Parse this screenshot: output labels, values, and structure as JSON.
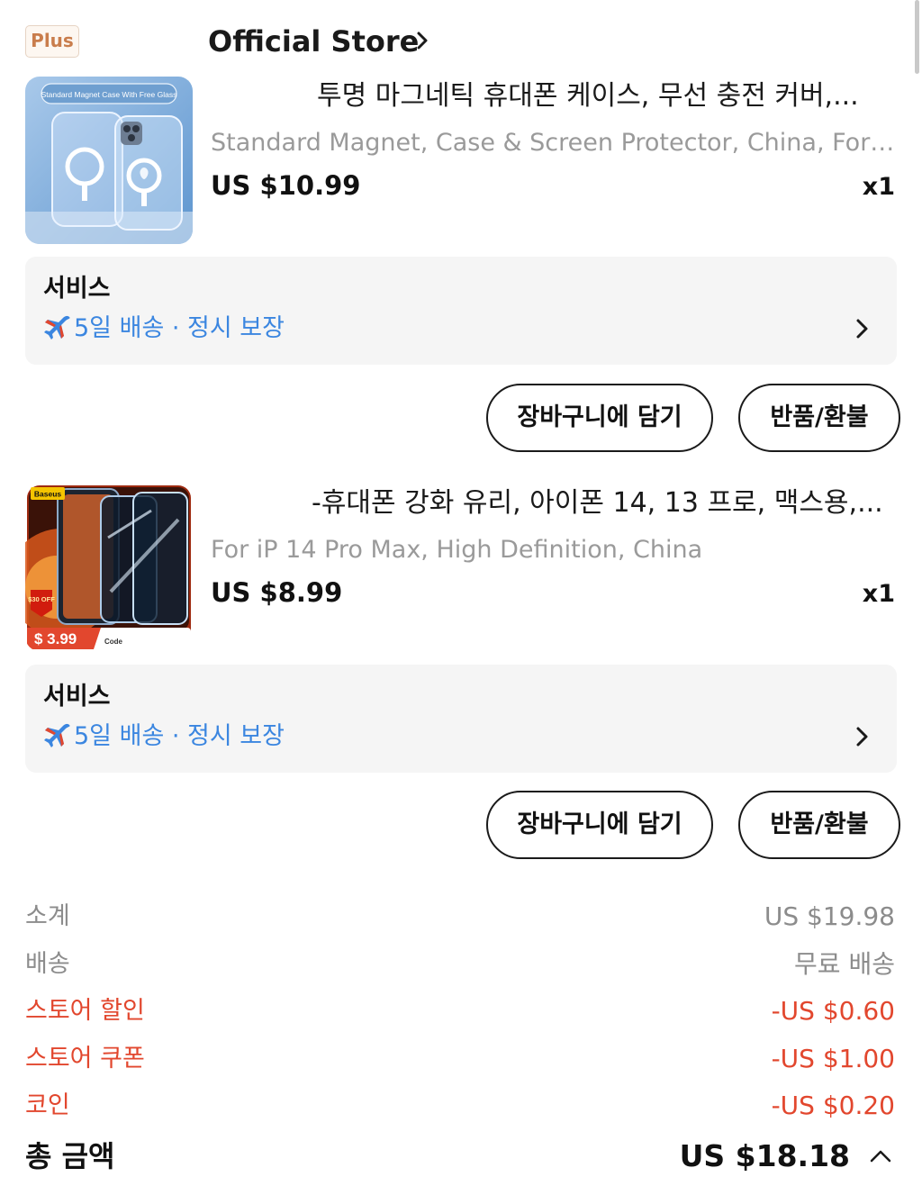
{
  "store": {
    "badge": "Plus",
    "name": "Official Store"
  },
  "items": [
    {
      "title": "투명 마그네틱 휴대폰 케이스, 무선 충전 커버,...",
      "variant": "Standard Magnet, Case & Screen Protector, China, For i...",
      "price": "US $10.99",
      "qty": "x1",
      "thumb_text": "Standard Magnet Case With Free Glass",
      "service_title": "서비스",
      "service_detail": "5일 배송 · 정시 보장",
      "cart_label": "장바구니에 담기",
      "refund_label": "반품/환불"
    },
    {
      "title": "-휴대폰 강화 유리, 아이폰 14, 13 프로, 맥스용,...",
      "variant": "For iP 14 Pro Max, High Definition, China",
      "price": "US $8.99",
      "qty": "x1",
      "thumb_brand": "Baseus",
      "thumb_off": "$30 OFF",
      "thumb_price": "$ 3.99",
      "thumb_code": "Code",
      "service_title": "서비스",
      "service_detail": "5일 배송 · 정시 보장",
      "cart_label": "장바구니에 담기",
      "refund_label": "반품/환불"
    }
  ],
  "summary": {
    "subtotal_label": "소계",
    "subtotal_value": "US $19.98",
    "shipping_label": "배송",
    "shipping_value": "무료 배송",
    "store_discount_label": "스토어 할인",
    "store_discount_value": "-US $0.60",
    "store_coupon_label": "스토어 쿠폰",
    "store_coupon_value": "-US $1.00",
    "coin_label": "코인",
    "coin_value": "-US $0.20",
    "total_label": "총 금액",
    "total_value": "US $18.18"
  },
  "colors": {
    "service_blue": "#3b86e0",
    "discount_red": "#e2472e",
    "plus_badge": "#c97d4c"
  },
  "icons": {
    "store_arrow": "chevron-right-icon",
    "service_plane": "airplane-icon",
    "service_arrow": "chevron-right-icon",
    "total_toggle": "caret-up-icon"
  }
}
